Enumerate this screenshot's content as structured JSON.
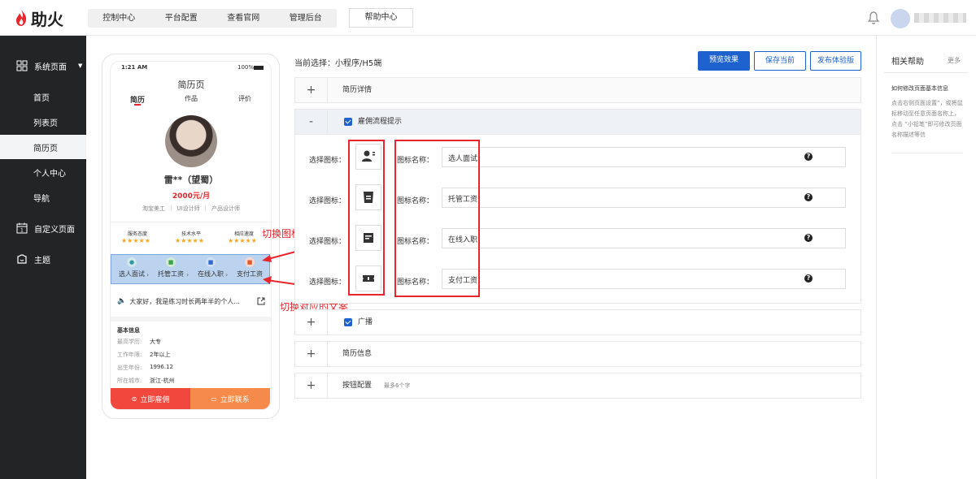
{
  "app": {
    "logo_text": "助火"
  },
  "topnav": {
    "items": [
      "控制中心",
      "平台配置",
      "查看官网",
      "管理后台"
    ],
    "help": "帮助中心"
  },
  "sidebar": {
    "group_label": "系统页面",
    "items": [
      "首页",
      "列表页",
      "简历页",
      "个人中心",
      "导航"
    ],
    "active_index": 2,
    "custom_page": "自定义页面",
    "theme": "主题"
  },
  "phone": {
    "time": "1:21 AM",
    "battery": "100%",
    "page_title": "简历页",
    "tabs": [
      "简历",
      "作品",
      "评价"
    ],
    "name": "雷**（望蜀）",
    "salary": "2000元/月",
    "tags": [
      "淘宝美工",
      "UI设计师",
      "产品设计师"
    ],
    "ratings": [
      {
        "label": "服务态度",
        "stars": 5
      },
      {
        "label": "技术水平",
        "stars": 5
      },
      {
        "label": "相应速度",
        "stars": 5
      }
    ],
    "steps": [
      "选人面试",
      "托管工资",
      "在线入职",
      "支付工资"
    ],
    "broadcast": "大家好，我是练习时长两年半的个人...",
    "basic_title": "基本信息",
    "basic": [
      {
        "k": "最高学历:",
        "v": "大专"
      },
      {
        "k": "工作年限:",
        "v": "2年以上"
      },
      {
        "k": "出生年份:",
        "v": "1996.12"
      },
      {
        "k": "所在城市:",
        "v": "浙江-杭州"
      }
    ],
    "hire_btn": "立即雇佣",
    "contact_btn": "立即联系"
  },
  "annotations": {
    "switch_icon": "切换图标",
    "switch_text": "切换对应的文案"
  },
  "editor": {
    "current": "当前选择：小程序/H5端",
    "preview_btn": "预览效果",
    "save_btn": "保存当前",
    "publish_btn": "发布体验版",
    "sections": {
      "resume_detail": "简历详情",
      "hire_process": "雇佣流程提示",
      "broadcast": "广播",
      "resume_info": "简历信息",
      "button_config": "按钮配置",
      "button_hint": "最多6个字"
    },
    "select_icon_label": "选择图标：",
    "icon_name_label": "图标名称：",
    "rows": [
      "选人面试",
      "托管工资",
      "在线入职",
      "支付工资"
    ]
  },
  "help": {
    "title": "相关帮助",
    "more": "更多",
    "item_title": "如何修改页面基本信息",
    "item_body": "点击右侧页面设置”，或将鼠标移动至任意页面名称上，点击 “小铅笔”即可修改页面名称描述等信"
  },
  "colors": {
    "accent": "#1e62d0",
    "red": "#e8262c",
    "orange": "#f5a623",
    "sidebar": "#222426"
  }
}
